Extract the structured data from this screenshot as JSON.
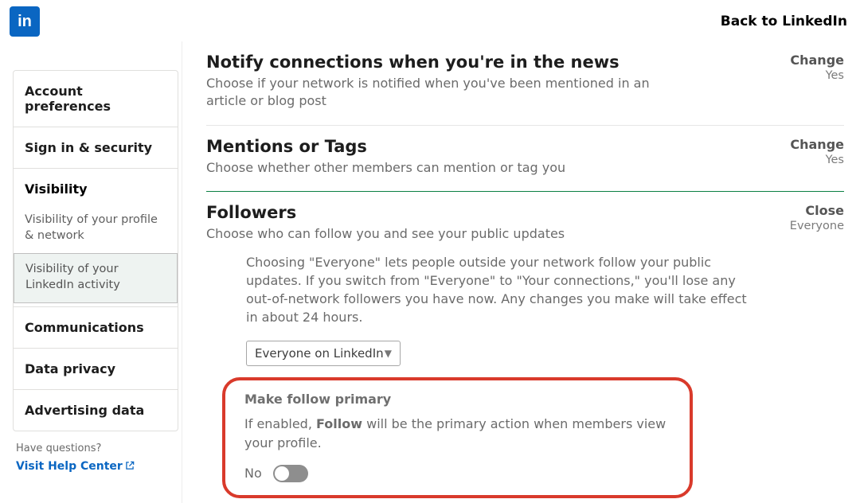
{
  "header": {
    "logo_text": "in",
    "back_label": "Back to LinkedIn"
  },
  "sidebar": {
    "items": [
      {
        "label": "Account preferences"
      },
      {
        "label": "Sign in & security"
      }
    ],
    "visibility": {
      "title": "Visibility",
      "subs": [
        {
          "label": "Visibility of your profile & network"
        },
        {
          "label": "Visibility of your LinkedIn activity"
        }
      ]
    },
    "tail": [
      {
        "label": "Communications"
      },
      {
        "label": "Data privacy"
      },
      {
        "label": "Advertising data"
      }
    ],
    "footer": {
      "question": "Have questions?",
      "link": "Visit Help Center"
    }
  },
  "main": {
    "news": {
      "title": "Notify connections when you're in the news",
      "desc": "Choose if your network is notified when you've been mentioned in an article or blog post",
      "action": "Change",
      "state": "Yes"
    },
    "mentions": {
      "title": "Mentions or Tags",
      "desc": "Choose whether other members can mention or tag you",
      "action": "Change",
      "state": "Yes"
    },
    "followers": {
      "title": "Followers",
      "desc": "Choose who can follow you and see your public updates",
      "action": "Close",
      "state": "Everyone",
      "help": "Choosing \"Everyone\" lets people outside your network follow your public updates. If you switch from \"Everyone\" to \"Your connections,\" you'll lose any out-of-network followers you have now. Any changes you make will take effect in about 24 hours.",
      "select_value": "Everyone on LinkedIn",
      "primary": {
        "title": "Make follow primary",
        "desc_pre": "If enabled, ",
        "desc_bold": "Follow",
        "desc_post": " will be the primary action when members view your profile.",
        "toggle_label": "No"
      }
    }
  }
}
